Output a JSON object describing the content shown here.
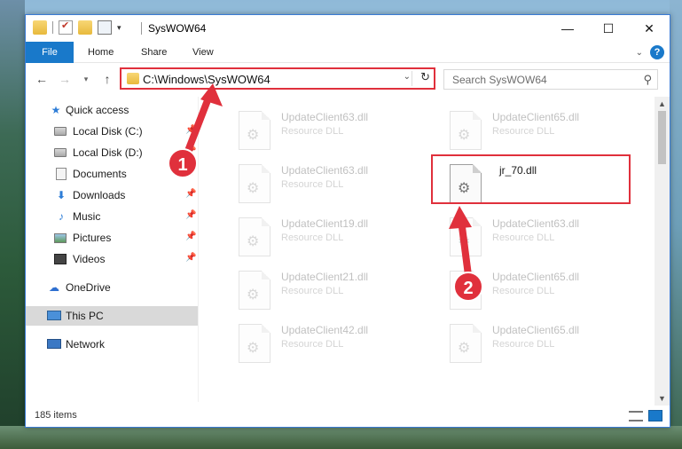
{
  "window": {
    "title": "SysWOW64",
    "controls": {
      "minimize": "—",
      "maximize": "☐",
      "close": "✕"
    }
  },
  "ribbon": {
    "tabs": [
      "File",
      "Home",
      "Share",
      "View"
    ],
    "help": "?"
  },
  "navigation": {
    "address": "C:\\Windows\\SysWOW64",
    "search_placeholder": "Search SysWOW64"
  },
  "nav_pane": {
    "items": [
      {
        "label": "Quick access",
        "icon": "star-icon",
        "pinned": false
      },
      {
        "label": "Local Disk (C:)",
        "icon": "disk-icon",
        "pinned": true
      },
      {
        "label": "Local Disk (D:)",
        "icon": "disk-icon",
        "pinned": true
      },
      {
        "label": "Documents",
        "icon": "documents-icon",
        "pinned": true
      },
      {
        "label": "Downloads",
        "icon": "downloads-icon",
        "pinned": true
      },
      {
        "label": "Music",
        "icon": "music-icon",
        "pinned": true
      },
      {
        "label": "Pictures",
        "icon": "pictures-icon",
        "pinned": true
      },
      {
        "label": "Videos",
        "icon": "videos-icon",
        "pinned": true
      },
      {
        "label": "OneDrive",
        "icon": "onedrive-icon",
        "pinned": false
      },
      {
        "label": "This PC",
        "icon": "this-pc-icon",
        "pinned": false,
        "selected": true
      },
      {
        "label": "Network",
        "icon": "network-icon",
        "pinned": false
      }
    ]
  },
  "files": [
    {
      "name": "UpdateClient63.dll",
      "type": "Resource DLL",
      "faded": true
    },
    {
      "name": "UpdateClient65.dll",
      "type": "Resource DLL",
      "faded": true
    },
    {
      "name": "UpdateClient63.dll",
      "type": "Resource DLL",
      "faded": true
    },
    {
      "name": "jr_70.dll",
      "type": "",
      "faded": false
    },
    {
      "name": "UpdateClient19.dll",
      "type": "Resource DLL",
      "faded": true
    },
    {
      "name": "UpdateClient63.dll",
      "type": "Resource DLL",
      "faded": true
    },
    {
      "name": "UpdateClient21.dll",
      "type": "Resource DLL",
      "faded": true
    },
    {
      "name": "UpdateClient65.dll",
      "type": "Resource DLL",
      "faded": true
    },
    {
      "name": "UpdateClient42.dll",
      "type": "Resource DLL",
      "faded": true
    },
    {
      "name": "UpdateClient65.dll",
      "type": "Resource DLL",
      "faded": true
    }
  ],
  "status": {
    "item_count": "185 items"
  },
  "annotations": {
    "callout_1": "1",
    "callout_2": "2",
    "accent_color": "#e0303c"
  }
}
